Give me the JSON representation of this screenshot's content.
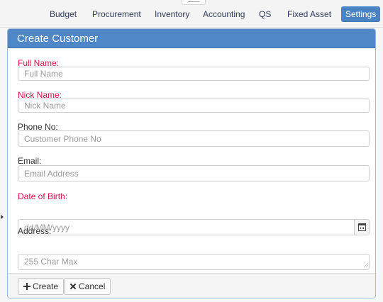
{
  "nav": {
    "items": [
      {
        "label": "Budget"
      },
      {
        "label": "Procurement"
      },
      {
        "label": "Inventory"
      },
      {
        "label": "Accounting"
      },
      {
        "label": "QS"
      },
      {
        "label": "Fixed Asset"
      },
      {
        "label": "Settings",
        "active": true
      }
    ]
  },
  "modal": {
    "title": "Create Customer",
    "fields": {
      "full_name": {
        "label": "Full Name:",
        "placeholder": "Full Name",
        "required_color": "#e0114d"
      },
      "nick_name": {
        "label": "Nick Name:",
        "placeholder": "Nick Name",
        "required_color": "#e0114d"
      },
      "phone_no": {
        "label": "Phone No:",
        "placeholder": "Customer Phone No"
      },
      "email": {
        "label": "Email:",
        "placeholder": "Email Address"
      },
      "date_of_birth": {
        "label": "Date of Birth:",
        "placeholder": "dd/MM/yyyy",
        "required_color": "#e0114d",
        "icon": "calendar-icon"
      },
      "address": {
        "label": "Address:",
        "placeholder": "255 Char Max"
      }
    },
    "buttons": {
      "create": {
        "label": "Create",
        "icon": "plus-icon"
      },
      "cancel": {
        "label": "Cancel",
        "icon": "close-icon"
      }
    }
  },
  "colors": {
    "header_blue": "#4f87c7",
    "active_nav_blue": "#4a83c3",
    "required_label": "#e0114d"
  }
}
